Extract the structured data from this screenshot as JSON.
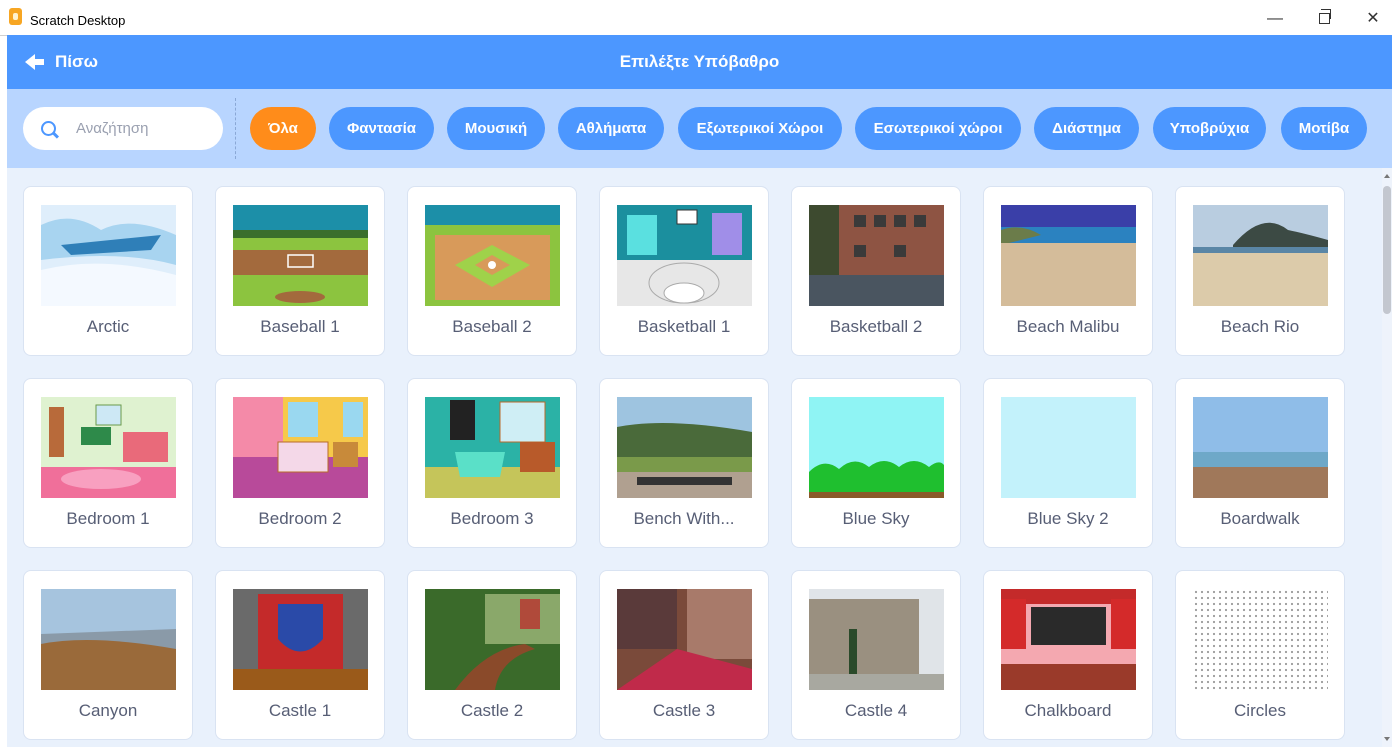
{
  "window": {
    "title": "Scratch Desktop",
    "minimize_glyph": "—",
    "close_glyph": "✕"
  },
  "header": {
    "back_label": "Πίσω",
    "title": "Επιλέξτε Υπόβαθρο"
  },
  "search": {
    "placeholder": "Αναζήτηση",
    "value": ""
  },
  "tags": [
    {
      "label": "Όλα",
      "active": true
    },
    {
      "label": "Φαντασία",
      "active": false
    },
    {
      "label": "Μουσική",
      "active": false
    },
    {
      "label": "Αθλήματα",
      "active": false
    },
    {
      "label": "Εξωτερικοί Χώροι",
      "active": false
    },
    {
      "label": "Εσωτερικοί χώροι",
      "active": false
    },
    {
      "label": "Διάστημα",
      "active": false
    },
    {
      "label": "Υποβρύχια",
      "active": false
    },
    {
      "label": "Μοτίβα",
      "active": false
    }
  ],
  "backdrops": [
    {
      "name": "Arctic"
    },
    {
      "name": "Baseball 1"
    },
    {
      "name": "Baseball 2"
    },
    {
      "name": "Basketball 1"
    },
    {
      "name": "Basketball 2"
    },
    {
      "name": "Beach Malibu"
    },
    {
      "name": "Beach Rio"
    },
    {
      "name": "Bedroom 1"
    },
    {
      "name": "Bedroom 2"
    },
    {
      "name": "Bedroom 3"
    },
    {
      "name": "Bench With..."
    },
    {
      "name": "Blue Sky"
    },
    {
      "name": "Blue Sky 2"
    },
    {
      "name": "Boardwalk"
    },
    {
      "name": "Canyon"
    },
    {
      "name": "Castle 1"
    },
    {
      "name": "Castle 2"
    },
    {
      "name": "Castle 3"
    },
    {
      "name": "Castle 4"
    },
    {
      "name": "Chalkboard"
    },
    {
      "name": "Circles"
    }
  ],
  "colors": {
    "header": "#4c97ff",
    "filter_bar": "#b8d5ff",
    "active_tag": "#ff8c1a",
    "library_bg": "#e9f1fc"
  }
}
